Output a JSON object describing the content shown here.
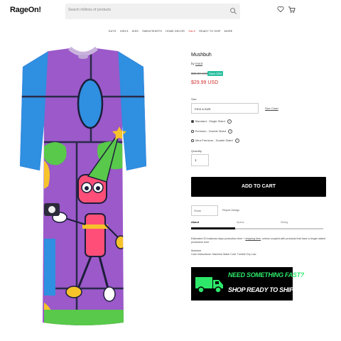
{
  "header": {
    "logo": "RageOn!",
    "search_placeholder": "Search millions of products",
    "icons": [
      "heart-icon",
      "cart-icon",
      "search-icon"
    ]
  },
  "nav": {
    "items": [
      "GUYS",
      "GIRLS",
      "KIDS",
      "SWEATSHIRTS",
      "HOME DECOR",
      "SALE",
      "READY TO SHIP",
      "MORE"
    ]
  },
  "product": {
    "title": "Mushbuh",
    "by_label": "by",
    "artist": "moot",
    "old_price": "$38.00 USD",
    "save_badge": "Save 25%",
    "price": "$29.99 USD",
    "size_label": "Size",
    "size_value": "PICK A SIZE",
    "size_chart": "Size Chart",
    "options": [
      {
        "label": "Standard - Single Sided",
        "selected": true
      },
      {
        "label": "Premium - Double Sided",
        "selected": false
      },
      {
        "label": "Ultra Premium - Double Sided",
        "selected": false
      }
    ],
    "qty_label": "Quantity",
    "qty_value": "1",
    "add_to_cart": "ADD TO CART",
    "share": "Share",
    "report": "Report Design",
    "tabs": [
      "About",
      "Specs",
      "Sizing"
    ],
    "about_part1": "Estimated 20 business days production time + ",
    "about_link": "shipping time",
    "about_part2": ", unless coupled with products that have a longer stated production time.",
    "material_label": "Moisture",
    "care": "Care Instructions: Machine Wash Cold. Tumble Dry Low",
    "promo_line1": "NEED SOMETHING FAST?",
    "promo_line2": "SHOP READY TO SHIP."
  },
  "colors": {
    "accent_red": "#d32f2f",
    "badge_green": "#2bbf9f",
    "promo_green": "#2ee86a"
  }
}
